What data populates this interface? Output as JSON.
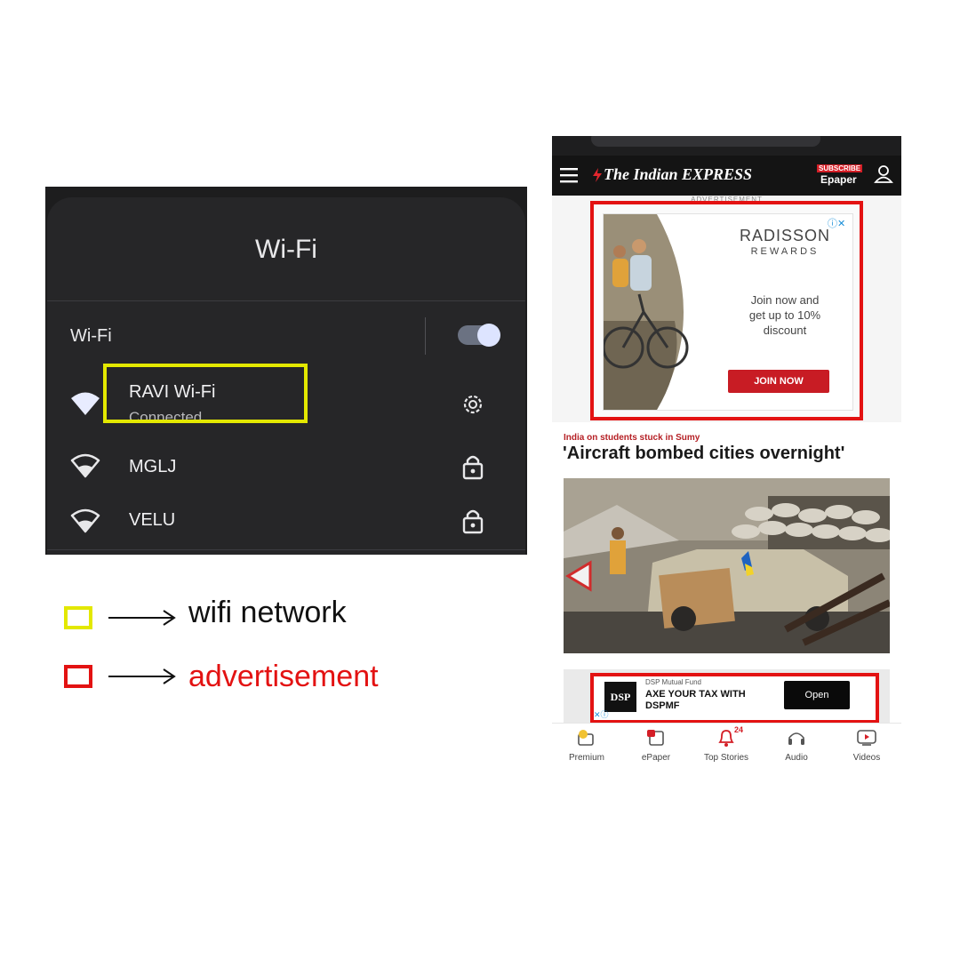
{
  "wifi": {
    "title": "Wi-Fi",
    "toggle_label": "Wi-Fi",
    "toggle_on": true,
    "networks": [
      {
        "name": "RAVI Wi-Fi",
        "status": "Connected",
        "action_icon": "gear-icon"
      },
      {
        "name": "MGLJ",
        "status": "",
        "action_icon": "lock-icon"
      },
      {
        "name": "VELU",
        "status": "",
        "action_icon": "lock-icon"
      }
    ]
  },
  "legend": [
    {
      "label": "wifi network",
      "color": "#e3e800"
    },
    {
      "label": "advertisement",
      "color": "#e31212"
    }
  ],
  "news": {
    "brand": "The Indian EXPRESS",
    "subscribe": "SUBSCRIBE",
    "epaper": "Epaper",
    "ad_label": "ADVERTISEMENT",
    "ad1": {
      "brand": "RADISSON",
      "brand_sub": "REWARDS",
      "copy_lines": [
        "Join now and",
        "get up to 10%",
        "discount"
      ],
      "cta": "JOIN NOW"
    },
    "kicker": "India on students stuck in Sumy",
    "headline": "'Aircraft bombed cities overnight'",
    "ad2": {
      "logo": "DSP",
      "sponsor": "DSP Mutual Fund",
      "line1": "AXE YOUR TAX WITH",
      "line2": "DSPMF",
      "cta": "Open"
    },
    "nav": [
      {
        "label": "Premium",
        "icon": "premium-icon"
      },
      {
        "label": "ePaper",
        "icon": "epaper-icon"
      },
      {
        "label": "Top Stories",
        "icon": "bell-icon",
        "badge": "24"
      },
      {
        "label": "Audio",
        "icon": "headphones-icon"
      },
      {
        "label": "Videos",
        "icon": "video-icon"
      }
    ]
  }
}
